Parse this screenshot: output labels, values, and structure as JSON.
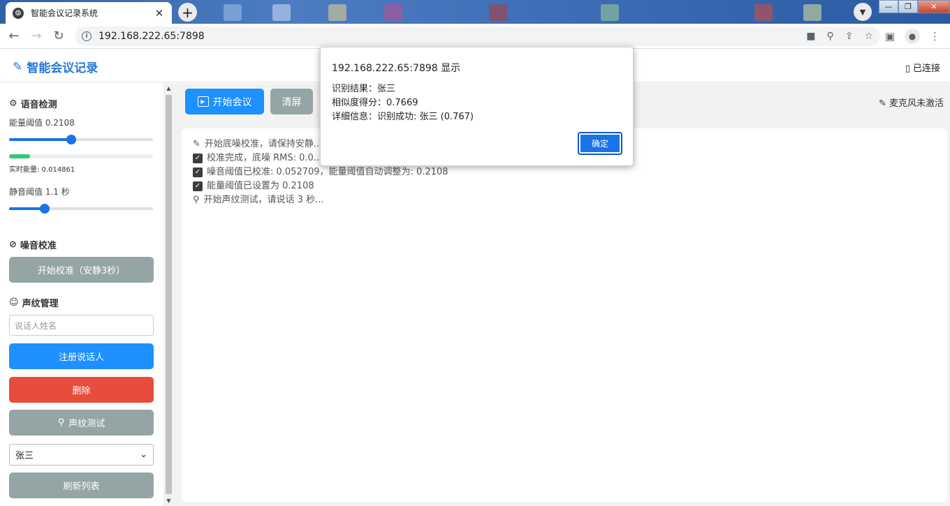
{
  "browser": {
    "tab_title": "智能会议记录系统",
    "tab_close": "✕",
    "new_tab": "+",
    "url": "192.168.222.65:7898",
    "win_minimize": "—",
    "win_restore": "❐",
    "win_close": "✕"
  },
  "header": {
    "brand": "智能会议记录",
    "connection": "已连接"
  },
  "sidebar": {
    "voice_detect_title": "语音检测",
    "energy_label": "能量阈值 0.2108",
    "energy_threshold": 0.2108,
    "realtime_energy_label": "实时能量: 0.014861",
    "realtime_energy": 0.014861,
    "silence_label": "静音阈值 1.1 秒",
    "silence_seconds": 1.1,
    "noise_title": "噪音校准",
    "calibrate_button": "开始校准（安静3秒）",
    "voiceprint_title": "声纹管理",
    "speaker_placeholder": "说话人姓名",
    "register_button": "注册说话人",
    "delete_button": "删除",
    "test_button": "声纹测试",
    "speaker_select": "张三",
    "refresh_button": "刷新列表"
  },
  "main": {
    "start_button": "开始会议",
    "clear_button": "清屏",
    "mic_status": "麦克风未激活",
    "log": [
      {
        "icon": "pencil",
        "text": "开始底噪校准，请保持安静..."
      },
      {
        "icon": "check",
        "text": "校准完成，底噪 RMS: 0.0..."
      },
      {
        "icon": "check",
        "text": "噪音阈值已校准: 0.052709，能量阈值自动调整为: 0.2108"
      },
      {
        "icon": "check",
        "text": "能量阈值已设置为 0.2108"
      },
      {
        "icon": "search",
        "text": "开始声纹测试，请说话 3 秒..."
      }
    ]
  },
  "dialog": {
    "title": "192.168.222.65:7898 显示",
    "line1": "识别结果：张三",
    "line2": "相似度得分：0.7669",
    "line3": "详细信息：识别成功: 张三 (0.767)",
    "ok_button": "确定"
  },
  "colors": {
    "accent": "#1e90ff",
    "danger": "#e74c3c",
    "muted": "#95a5a6",
    "meter": "#2ecc71"
  }
}
